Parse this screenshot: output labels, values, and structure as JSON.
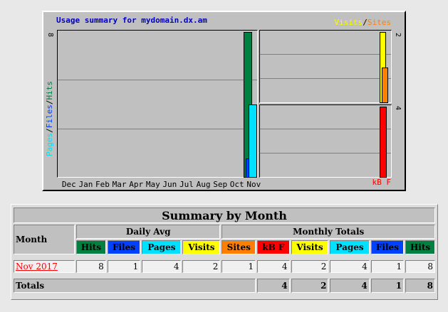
{
  "graph": {
    "title": "Usage summary for mydomain.dx.am",
    "legend_visits": "Visits",
    "legend_sep": "/",
    "legend_sites": "Sites",
    "legend_kb": "kB",
    "legend_f": "F",
    "vlabel_pages": "Pages",
    "vlabel_files": "Files",
    "vlabel_hits": "Hits",
    "main_max": "8",
    "visits_max": "2",
    "kb_max": "4",
    "months": [
      "Dec",
      "Jan",
      "Feb",
      "Mar",
      "Apr",
      "May",
      "Jun",
      "Jul",
      "Aug",
      "Sep",
      "Oct",
      "Nov"
    ],
    "colors": {
      "hits": "#008040",
      "files": "#0040ff",
      "pages": "#00e0ff",
      "visits": "#ffff00",
      "sites": "#ff8000",
      "kbytes": "#ff0000",
      "title": "#0000c0"
    }
  },
  "summary": {
    "title": "Summary by Month",
    "month_header": "Month",
    "daily_avg": "Daily Avg",
    "monthly_totals": "Monthly Totals",
    "daily_cols": [
      "Hits",
      "Files",
      "Pages",
      "Visits"
    ],
    "monthly_cols": [
      "Sites",
      "kB F",
      "Visits",
      "Pages",
      "Files",
      "Hits"
    ],
    "rows": [
      {
        "month": "Nov 2017",
        "daily": [
          "8",
          "1",
          "4",
          "2"
        ],
        "monthly": [
          "1",
          "4",
          "2",
          "4",
          "1",
          "8"
        ]
      }
    ],
    "totals_label": "Totals",
    "totals": [
      "4",
      "2",
      "4",
      "1",
      "8"
    ]
  }
}
